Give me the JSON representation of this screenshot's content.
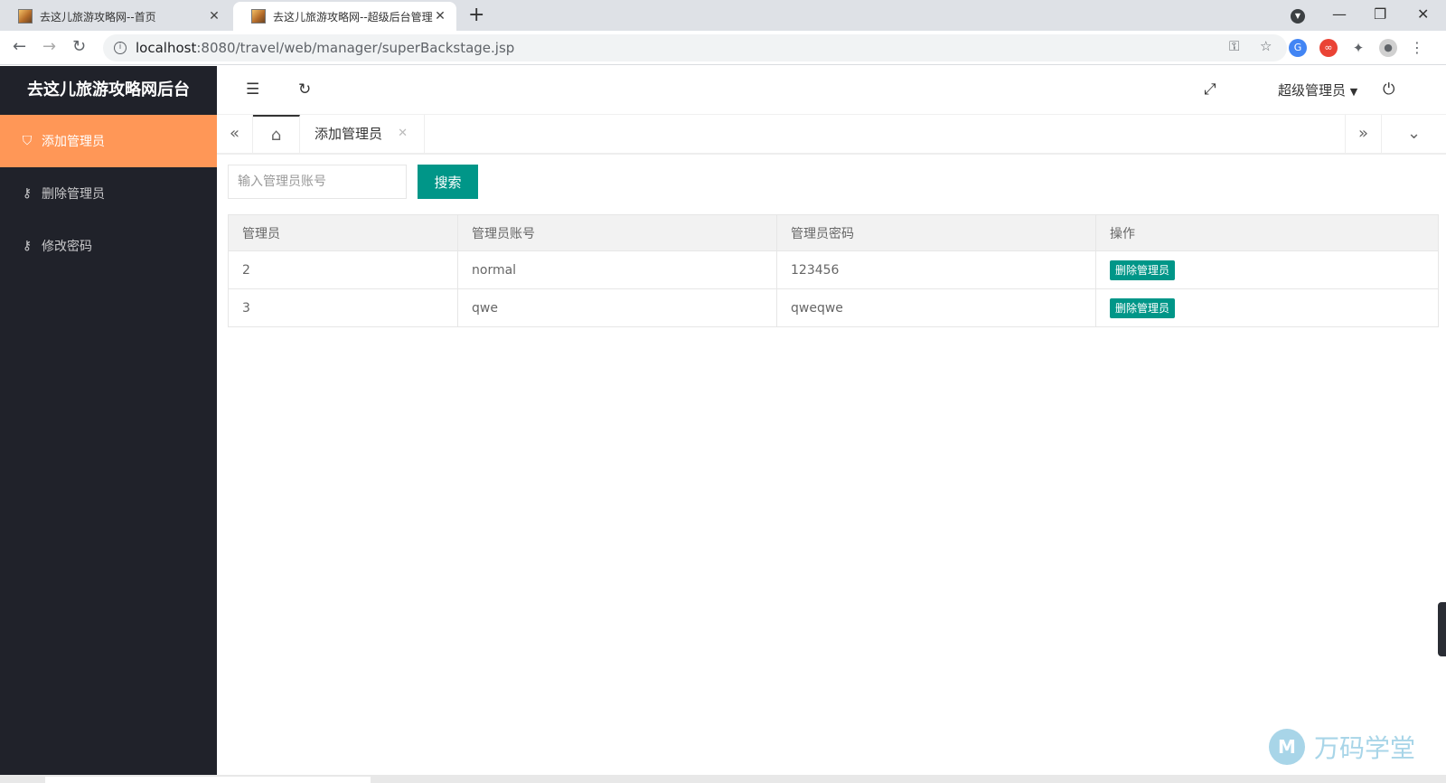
{
  "browser": {
    "tabs": [
      {
        "title": "去这儿旅游攻略网--首页",
        "active": false
      },
      {
        "title": "去这儿旅游攻略网--超级后台管理",
        "active": true
      }
    ],
    "url_host": "localhost",
    "url_rest": ":8080/travel/web/manager/superBackstage.jsp"
  },
  "sidebar": {
    "logo": "去这儿旅游攻略网后台",
    "items": [
      {
        "label": "添加管理员",
        "icon": "shield-icon",
        "active": true
      },
      {
        "label": "删除管理员",
        "icon": "key-icon",
        "active": false
      },
      {
        "label": "修改密码",
        "icon": "key-icon",
        "active": false
      }
    ]
  },
  "header": {
    "user": "超级管理员"
  },
  "tabs": {
    "current": "添加管理员"
  },
  "search": {
    "placeholder": "输入管理员账号",
    "button": "搜索"
  },
  "table": {
    "headers": [
      "管理员",
      "管理员账号",
      "管理员密码",
      "操作"
    ],
    "rows": [
      {
        "id": "2",
        "account": "normal",
        "password": "123456",
        "action": "删除管理员"
      },
      {
        "id": "3",
        "account": "qwe",
        "password": "qweqwe",
        "action": "删除管理员"
      }
    ]
  },
  "watermark": {
    "logo_letter": "M",
    "text": "万码学堂"
  },
  "colors": {
    "accent_orange": "#ff9757",
    "primary_teal": "#009688",
    "sidebar_bg": "#20222a"
  }
}
